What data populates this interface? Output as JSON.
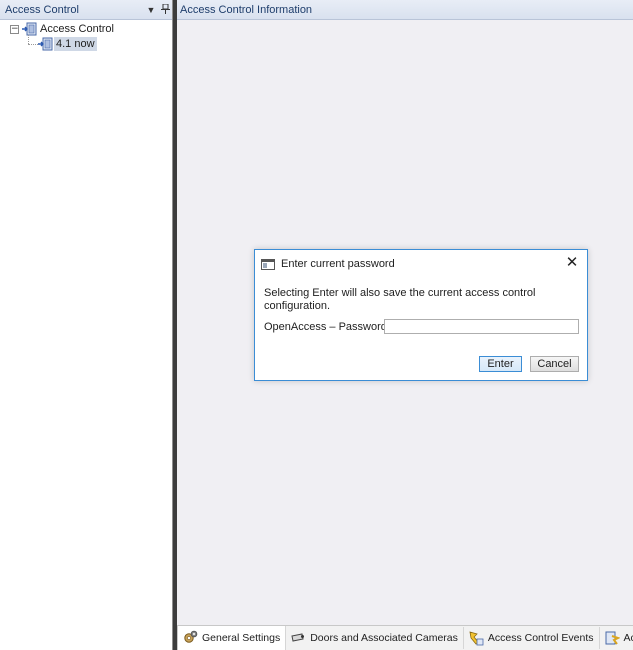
{
  "left_pane": {
    "title": "Access Control",
    "dropdown_glyph": "▼",
    "pin_glyph": "📌",
    "tree": {
      "root": {
        "label": "Access Control",
        "expander": "−",
        "icon": "access-control-icon"
      },
      "child": {
        "label": "4.1 now",
        "icon": "access-control-icon"
      }
    }
  },
  "right_pane": {
    "title": "Access Control Information"
  },
  "tabs": [
    {
      "label": "General Settings",
      "icon": "gear-icon"
    },
    {
      "label": "Doors and Associated Cameras",
      "icon": "camera-icon"
    },
    {
      "label": "Access Control Events",
      "icon": "events-icon"
    },
    {
      "label": "Access Requ",
      "icon": "request-icon"
    }
  ],
  "dialog": {
    "title": "Enter current password",
    "close_glyph": "✕",
    "message": "Selecting Enter will also save the current access control configuration.",
    "password_label": "OpenAccess – Password:",
    "password_value": "",
    "enter_label": "Enter",
    "cancel_label": "Cancel"
  },
  "colors": {
    "header_text": "#1e3d6b",
    "dialog_border": "#3b8dd5",
    "panel_bg": "#f0eff3",
    "selection": "#cfd8e6"
  }
}
